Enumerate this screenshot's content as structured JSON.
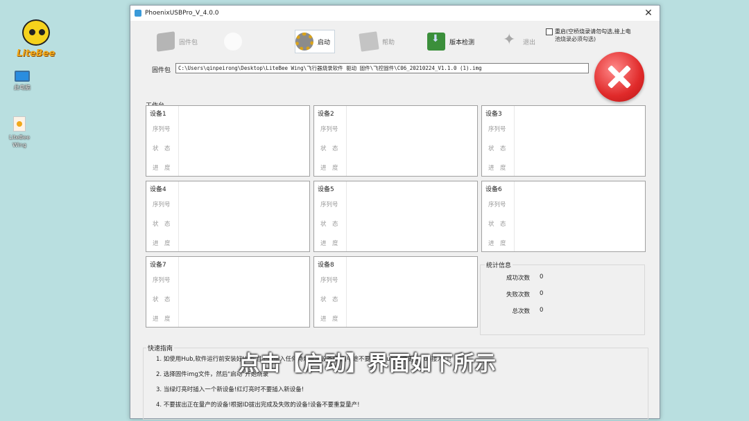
{
  "desktop": {
    "logo_text": "LiteBee",
    "pc_label": "此电脑",
    "wing_label_1": "LiteBee",
    "wing_label_2": "Wing"
  },
  "window": {
    "title": "PhoenixUSBPro_V_4.0.0",
    "close_glyph": "✕"
  },
  "toolbar": {
    "firmware_pkg": "固件包",
    "start": "启动",
    "help": "帮助",
    "version_check": "版本检测",
    "exit": "退出"
  },
  "restart": {
    "line1": "重启(空桥烧录请勿勾选,接上电",
    "line2": "池烧录必须勾选)",
    "checked": false
  },
  "firmware": {
    "label": "固件包",
    "path": "C:\\Users\\qinpeirong\\Desktop\\LiteBee Wing\\飞行器烧录软件 驱动 固件\\飞控固件\\C06_20210224_V1.1.0 (1).img"
  },
  "workbench_label": "工作台",
  "device_fields": {
    "serial": "序列号",
    "status": "状　态",
    "progress": "进　度"
  },
  "devices": [
    {
      "name": "设备1"
    },
    {
      "name": "设备2"
    },
    {
      "name": "设备3"
    },
    {
      "name": "设备4"
    },
    {
      "name": "设备5"
    },
    {
      "name": "设备6"
    },
    {
      "name": "设备7"
    },
    {
      "name": "设备8"
    }
  ],
  "stats": {
    "title": "统计信息",
    "success_label": "成功次数",
    "success_value": "0",
    "fail_label": "失败次数",
    "fail_value": "0",
    "total_label": "总次数",
    "total_value": "0"
  },
  "guide": {
    "title": "快速指南",
    "lines": [
      "1. 如使用Hub,软件运行前安装好Hub,且不要插入任何待烧录的设备(使用中途不要插拔Hub,不要更换Hub接入口!",
      "2. 选择固件img文件，然后\"启动\"开始烧录",
      "3. 当绿灯亮时插入一个新设备!红灯亮时不要插入新设备!",
      "4. 不要拔出正在量产的设备!根据ID拔出完成及失败的设备!设备不要重复量产!"
    ]
  },
  "caption": "点击【启动】界面如下所示"
}
